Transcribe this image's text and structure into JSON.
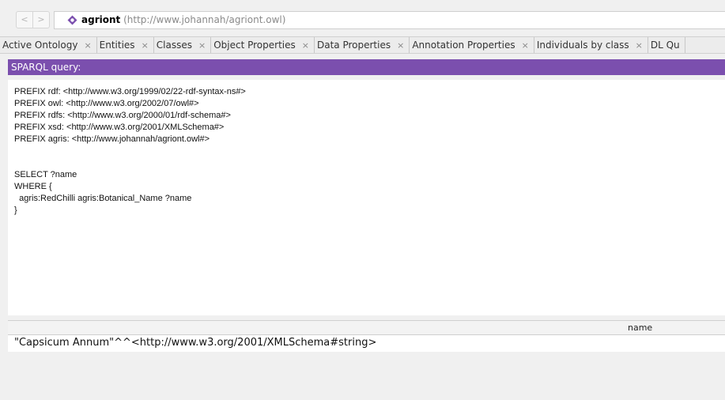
{
  "nav": {
    "back_icon": "<",
    "forward_icon": ">"
  },
  "ontology": {
    "name": "agriont",
    "iri": "(http://www.johannah/agriont.owl)",
    "icon": "ontology-diamond-icon",
    "icon_color": "#7b4fae"
  },
  "tabs": [
    {
      "label": "Active Ontology"
    },
    {
      "label": "Entities"
    },
    {
      "label": "Classes"
    },
    {
      "label": "Object Properties"
    },
    {
      "label": "Data Properties"
    },
    {
      "label": "Annotation Properties"
    },
    {
      "label": "Individuals by class"
    },
    {
      "label": "DL Qu"
    }
  ],
  "tab_close_glyph": "×",
  "sparql": {
    "header": "SPARQL query:",
    "header_color": "#7b4fae",
    "lines": [
      "PREFIX rdf: <http://www.w3.org/1999/02/22-rdf-syntax-ns#>",
      "PREFIX owl: <http://www.w3.org/2002/07/owl#>",
      "PREFIX rdfs: <http://www.w3.org/2000/01/rdf-schema#>",
      "PREFIX xsd: <http://www.w3.org/2001/XMLSchema#>",
      "PREFIX agris: <http://www.johannah/agriont.owl#>",
      "",
      "SELECT ?name",
      "WHERE {",
      "  agris:RedChilli agris:Botanical_Name ?name",
      "}"
    ]
  },
  "results": {
    "column_header": "name",
    "rows": [
      "\"Capsicum Annum\"^^<http://www.w3.org/2001/XMLSchema#string>"
    ]
  }
}
